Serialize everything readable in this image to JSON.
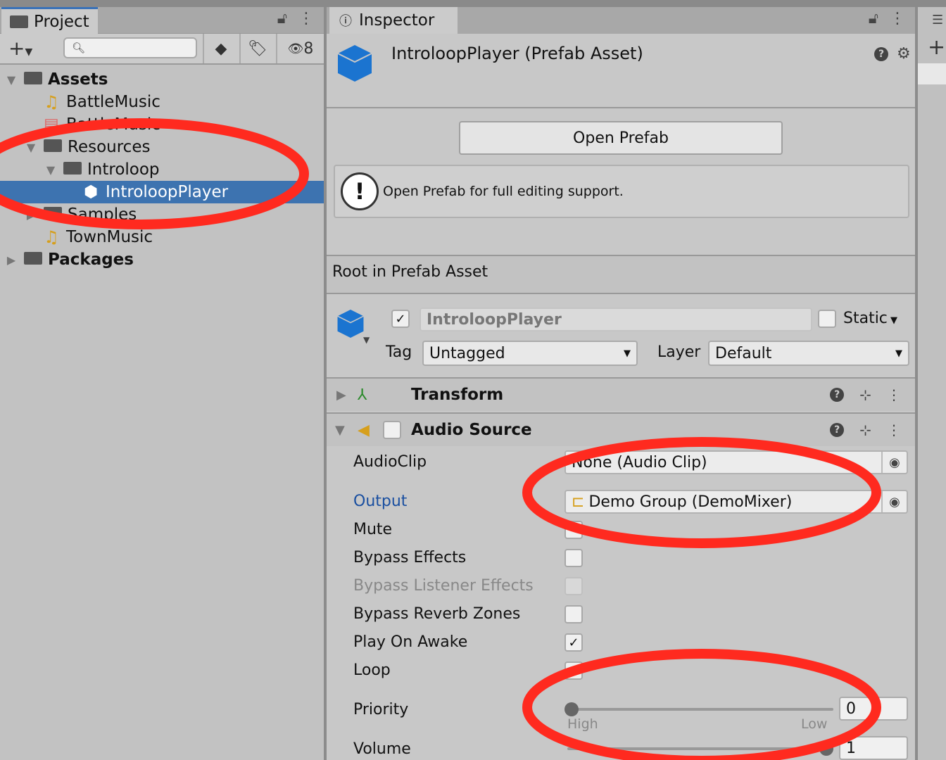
{
  "project": {
    "tab_label": "Project",
    "hidden_count": "8",
    "search_placeholder": "",
    "tree": [
      {
        "label": "Assets",
        "icon": "folder-open-icon",
        "expanded": true,
        "bold": true
      },
      {
        "label": "BattleMusic",
        "icon": "audio-clip-icon"
      },
      {
        "label": "BattleMusic",
        "icon": "mixer-icon"
      },
      {
        "label": "Resources",
        "icon": "folder-open-icon",
        "expanded": true
      },
      {
        "label": "Introloop",
        "icon": "folder-open-icon",
        "expanded": true
      },
      {
        "label": "IntroloopPlayer",
        "icon": "prefab-icon",
        "selected": true
      },
      {
        "label": "Samples",
        "icon": "folder-icon",
        "expanded": false
      },
      {
        "label": "TownMusic",
        "icon": "audio-clip-icon"
      },
      {
        "label": "Packages",
        "icon": "folder-icon",
        "expanded": false,
        "bold": true
      }
    ]
  },
  "inspector": {
    "tab_label": "Inspector",
    "header_title": "IntroloopPlayer (Prefab Asset)",
    "open_prefab_label": "Open Prefab",
    "help_message": "Open Prefab for full editing support.",
    "root_label": "Root in Prefab Asset",
    "object": {
      "active": true,
      "name": "IntroloopPlayer",
      "static_label": "Static",
      "static": false,
      "tag_label": "Tag",
      "tag_value": "Untagged",
      "layer_label": "Layer",
      "layer_value": "Default"
    },
    "components": {
      "transform": "Transform",
      "audio_source": "Audio Source"
    },
    "audio_source": {
      "audioclip_label": "AudioClip",
      "audioclip_value": "None (Audio Clip)",
      "output_label": "Output",
      "output_value": "Demo Group (DemoMixer)",
      "mute_label": "Mute",
      "bypass_effects_label": "Bypass Effects",
      "bypass_listener_label": "Bypass Listener Effects",
      "bypass_reverb_label": "Bypass Reverb Zones",
      "play_on_awake_label": "Play On Awake",
      "loop_label": "Loop",
      "priority_label": "Priority",
      "priority_value": "0",
      "priority_high": "High",
      "priority_low": "Low",
      "volume_label": "Volume",
      "volume_value": "1",
      "mute": false,
      "bypass_effects": false,
      "bypass_reverb": false,
      "play_on_awake": true,
      "loop": false
    }
  },
  "colors": {
    "selection": "#3d73b0",
    "annotation": "#ff2a1f",
    "prefab_blue": "#1b74d0",
    "output_link": "#1a4fa0"
  }
}
